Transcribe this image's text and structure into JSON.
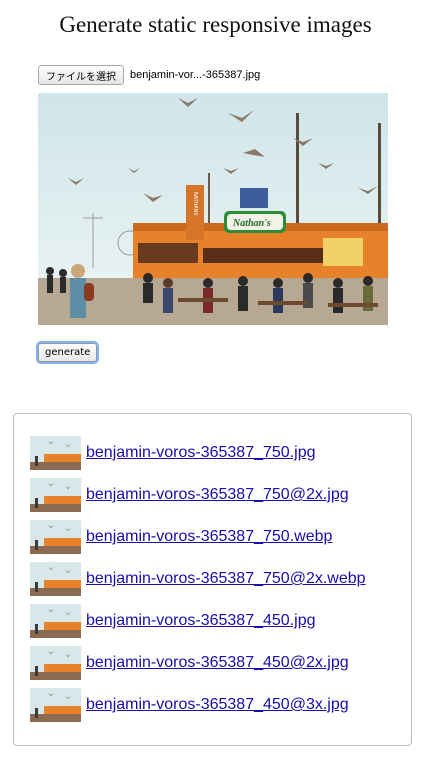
{
  "page": {
    "title": "Generate static responsive images"
  },
  "file_input": {
    "button_label": "ファイルを選択",
    "file_name": "benjamin-vor...-365387.jpg"
  },
  "preview_image": {
    "icon": "image-preview",
    "sign_text": "Nathan's",
    "vertical_sign": "NATHANS"
  },
  "generate_button": {
    "label": "generate"
  },
  "results": {
    "items": [
      {
        "label": "benjamin-voros-365387_750.jpg"
      },
      {
        "label": "benjamin-voros-365387_750@2x.jpg"
      },
      {
        "label": "benjamin-voros-365387_750.webp"
      },
      {
        "label": "benjamin-voros-365387_750@2x.webp"
      },
      {
        "label": "benjamin-voros-365387_450.jpg"
      },
      {
        "label": "benjamin-voros-365387_450@2x.jpg"
      },
      {
        "label": "benjamin-voros-365387_450@3x.jpg"
      }
    ]
  },
  "colors": {
    "link": "#1a0dab",
    "focus_ring": "#7fb2f0",
    "building_orange": "#e8822a",
    "sky": "#dcecf0"
  }
}
